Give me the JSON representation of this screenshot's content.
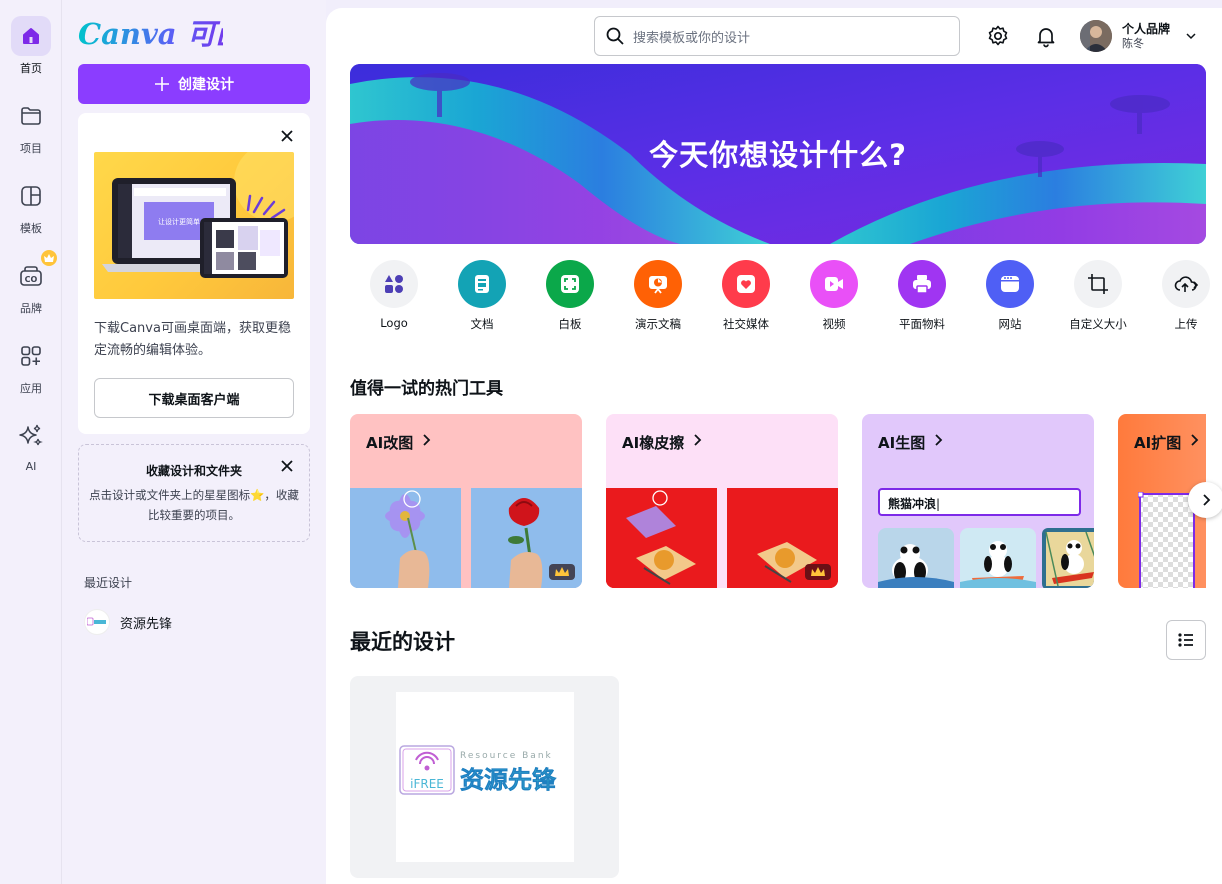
{
  "rail": {
    "items": [
      {
        "label": "首页",
        "icon": "home-icon"
      },
      {
        "label": "项目",
        "icon": "folder-icon"
      },
      {
        "label": "模板",
        "icon": "template-icon"
      },
      {
        "label": "品牌",
        "icon": "brand-icon"
      },
      {
        "label": "应用",
        "icon": "apps-icon"
      },
      {
        "label": "AI",
        "icon": "sparkle-icon"
      }
    ]
  },
  "panel": {
    "logo_text": "Canva 可画",
    "create_label": "创建设计",
    "promo": {
      "screen_text": "让设计更简单",
      "text": "下载Canva可画桌面端，获取更稳定流畅的编辑体验。",
      "download_label": "下载桌面客户端"
    },
    "tip": {
      "title": "收藏设计和文件夹",
      "text": "点击设计或文件夹上的星星图标⭐，收藏比较重要的项目。"
    },
    "recent_title": "最近设计",
    "recent_items": [
      {
        "label": "资源先锋"
      }
    ]
  },
  "header": {
    "search_placeholder": "搜索模板或你的设计",
    "user_name": "个人品牌",
    "user_sub": "陈冬"
  },
  "hero": {
    "title": "今天你想设计什么?"
  },
  "categories": [
    {
      "label": "Logo",
      "color": "#f1f2f4",
      "icon": "shapes-icon"
    },
    {
      "label": "文档",
      "color": "#13a3b5",
      "icon": "document-icon"
    },
    {
      "label": "白板",
      "color": "#0ba84a",
      "icon": "whiteboard-icon"
    },
    {
      "label": "演示文稿",
      "color": "#ff6105",
      "icon": "presentation-icon"
    },
    {
      "label": "社交媒体",
      "color": "#ff3b4b",
      "icon": "heart-icon"
    },
    {
      "label": "视频",
      "color": "#e950f7",
      "icon": "video-icon"
    },
    {
      "label": "平面物料",
      "color": "#a035f2",
      "icon": "printer-icon"
    },
    {
      "label": "网站",
      "color": "#4f5ff5",
      "icon": "website-icon"
    },
    {
      "label": "自定义大小",
      "color": "#f1f2f4",
      "icon": "crop-icon"
    },
    {
      "label": "上传",
      "color": "#f1f2f4",
      "icon": "cloud-upload-icon"
    }
  ],
  "tools_section": {
    "title": "值得一试的热门工具",
    "tools": [
      {
        "label": "AI改图",
        "bg": "#ffc2c2"
      },
      {
        "label": "AI橡皮擦",
        "bg": "#fde0f7"
      },
      {
        "label": "AI生图",
        "bg": "#e1c8fb",
        "input_value": "熊猫冲浪"
      },
      {
        "label": "AI扩图",
        "bg": "#ff8a4a"
      }
    ]
  },
  "recent_section": {
    "title": "最近的设计",
    "design": {
      "logo_badge": "iFREE",
      "logo_sub": "Resource Bank",
      "logo_title": "资源先锋"
    }
  }
}
